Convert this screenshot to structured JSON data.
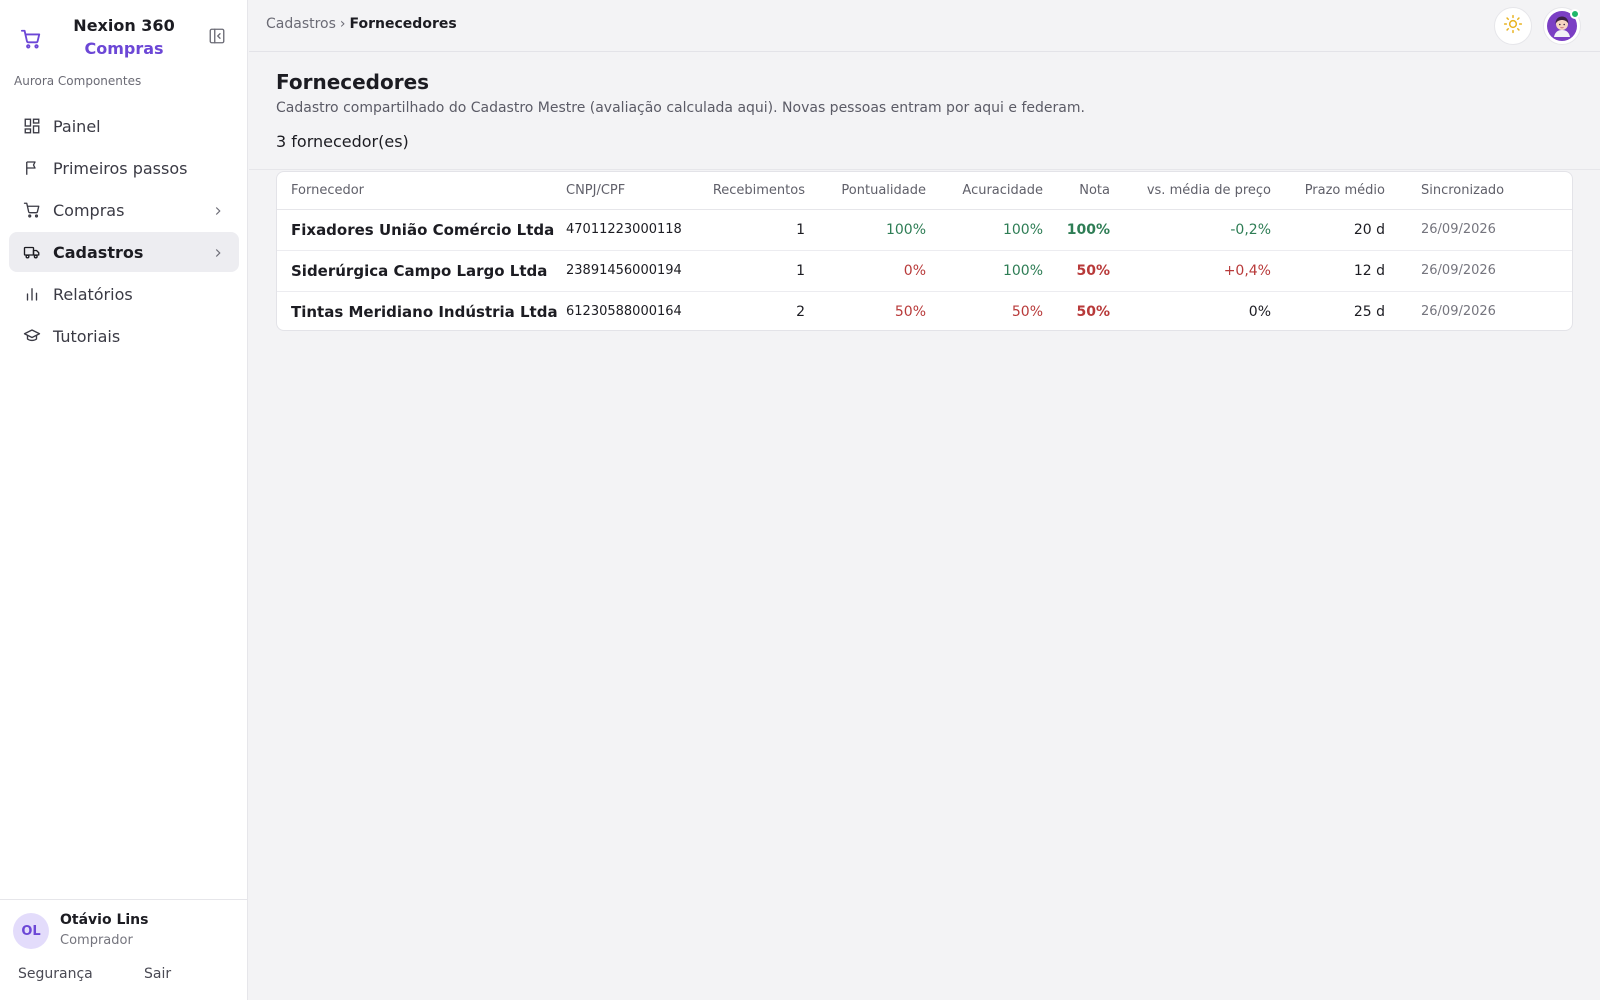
{
  "brand": {
    "title": "Nexion 360",
    "subtitle": "Compras",
    "org": "Aurora Componentes"
  },
  "nav": [
    {
      "label": "Painel",
      "icon": "dashboard-icon",
      "active": false,
      "chevron": false
    },
    {
      "label": "Primeiros passos",
      "icon": "flag-icon",
      "active": false,
      "chevron": false
    },
    {
      "label": "Compras",
      "icon": "cart-icon",
      "active": false,
      "chevron": true
    },
    {
      "label": "Cadastros",
      "icon": "truck-icon",
      "active": true,
      "chevron": true
    },
    {
      "label": "Relatórios",
      "icon": "bar-chart-icon",
      "active": false,
      "chevron": false
    },
    {
      "label": "Tutoriais",
      "icon": "graduation-cap-icon",
      "active": false,
      "chevron": false
    }
  ],
  "user": {
    "initials": "OL",
    "name": "Otávio Lins",
    "role": "Comprador",
    "security_label": "Segurança",
    "exit_label": "Sair"
  },
  "breadcrumb": {
    "parent": "Cadastros",
    "separator": "›",
    "current": "Fornecedores"
  },
  "page": {
    "title": "Fornecedores",
    "description": "Cadastro compartilhado do Cadastro Mestre (avaliação calculada aqui). Novas pessoas entram por aqui e federam.",
    "count": "3 fornecedor(es)"
  },
  "table": {
    "headers": {
      "supplier": "Fornecedor",
      "doc": "CNPJ/CPF",
      "receipts": "Recebimentos",
      "punctuality": "Pontualidade",
      "accuracy": "Acuracidade",
      "score": "Nota",
      "price": "vs. média de preço",
      "lead": "Prazo médio",
      "synced": "Sincronizado"
    },
    "rows": [
      {
        "supplier": "Fixadores União Comércio Ltda",
        "doc": "47011223000118",
        "receipts": "1",
        "punctuality": "100%",
        "accuracy": "100%",
        "score": "100%",
        "price": "-0,2%",
        "lead": "20 d",
        "synced": "26/09/2026"
      },
      {
        "supplier": "Siderúrgica Campo Largo Ltda",
        "doc": "23891456000194",
        "receipts": "1",
        "punctuality": "0%",
        "accuracy": "100%",
        "score": "50%",
        "price": "+0,4%",
        "lead": "12 d",
        "synced": "26/09/2026"
      },
      {
        "supplier": "Tintas Meridiano Indústria Ltda",
        "doc": "61230588000164",
        "receipts": "2",
        "punctuality": "50%",
        "accuracy": "50%",
        "score": "50%",
        "price": "0%",
        "lead": "25 d",
        "synced": "26/09/2026"
      }
    ]
  },
  "colors": {
    "accent": "#6c47d6",
    "positive": "#2e7d55",
    "negative": "#b83a3a",
    "online": "#1fb86a"
  }
}
